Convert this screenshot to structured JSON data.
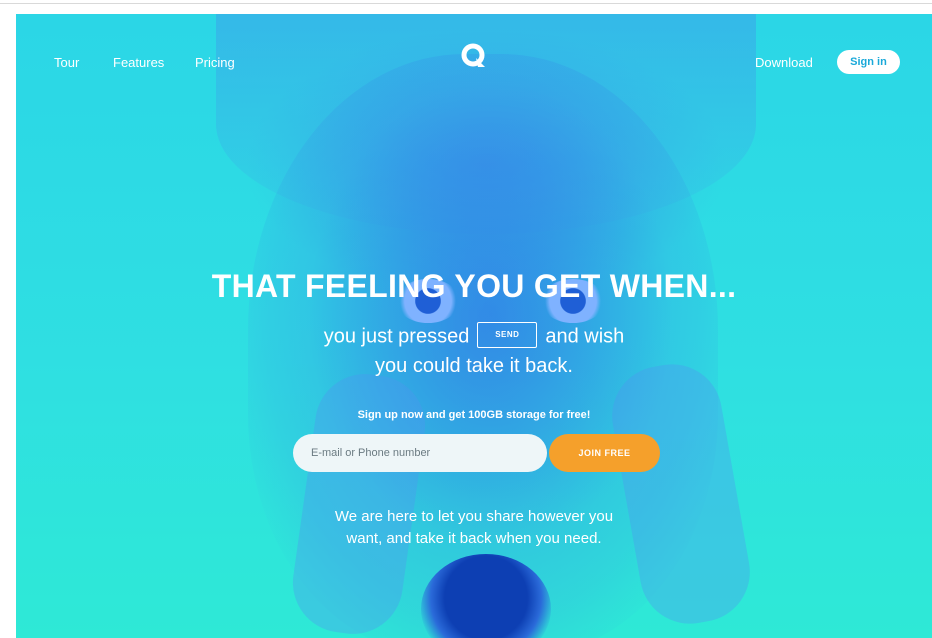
{
  "nav": {
    "left": [
      "Tour",
      "Features",
      "Pricing"
    ],
    "download": "Download",
    "signin": "Sign in",
    "logo_icon": "q-logo-icon"
  },
  "hero": {
    "headline": "THAT FEELING YOU GET WHEN...",
    "sub_before": "you just pressed",
    "send_label": "SEND",
    "sub_after": "and wish",
    "sub_line2": "you could take it back.",
    "promo": "Sign up now and get 100GB storage for free!",
    "email_placeholder": "E-mail or Phone number",
    "join_label": "JOIN FREE",
    "tagline_line1": "We are here to let you share however you",
    "tagline_line2": "want, and take it back when you need."
  },
  "colors": {
    "accent_orange": "#f5a02b",
    "background_cyan": "#2fdfe2",
    "signin_text": "#1aa9d9"
  }
}
